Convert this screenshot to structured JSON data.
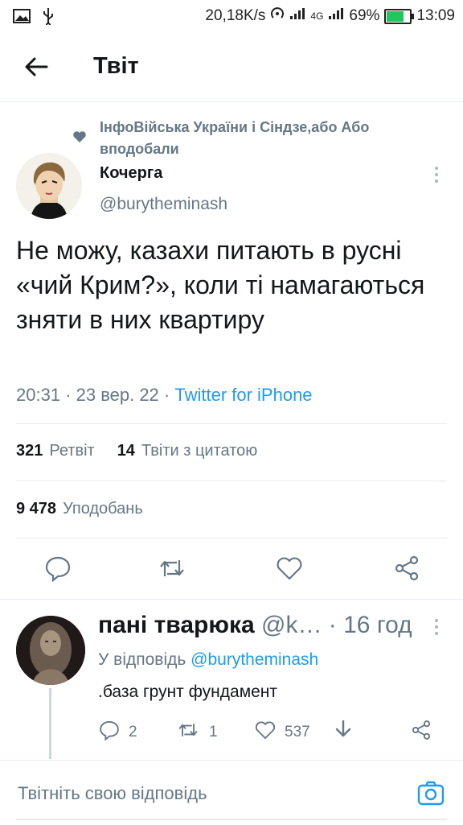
{
  "status_bar": {
    "network_speed": "20,18K/s",
    "network_type": "4G",
    "battery": "69%",
    "battery_level": 0.69,
    "time": "13:09"
  },
  "header": {
    "title": "Твіт"
  },
  "tweet": {
    "context_text": "ІнфоВійська України і Сіндзе,або Або вподобали",
    "author_name": "Кочерга",
    "author_handle": "@burytheminash",
    "text": "Не можу, казахи питають в русні «чий Крим?», коли ті намагаються зняти в них квартиру",
    "time": "20:31 · 23 вер. 22 · ",
    "source": "Twitter for iPhone",
    "retweets_count": "321",
    "retweets_label": "Ретвіт",
    "quotes_count": "14",
    "quotes_label": "Твіти з цитатою",
    "likes_count": "9 478",
    "likes_label": "Уподобань"
  },
  "reply": {
    "name": "пані тварюка",
    "handle_time": " @k… · 16 год",
    "reply_to_label": "У відповідь ",
    "reply_to_handle": "@burytheminash",
    "text": ".база грунт фундамент",
    "replies": "2",
    "retweets": "1",
    "likes": "537"
  },
  "compose": {
    "placeholder": "Твітніть свою відповідь"
  },
  "colors": {
    "accent": "#1d9bf0",
    "muted": "#657786",
    "divider": "#e6ecf0"
  }
}
